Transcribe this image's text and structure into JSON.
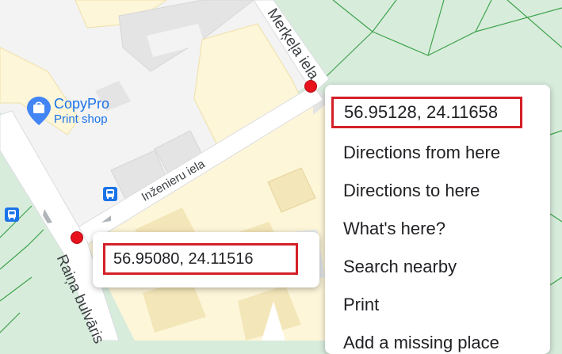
{
  "map": {
    "streets": {
      "merkela": "Merķeļa iela",
      "inzenieru": "Inženieru iela",
      "raina": "Raiņa bulvāris"
    },
    "poi": {
      "name": "CopyPro",
      "category": "Print shop",
      "icon": "shopping-bag-pin-icon"
    },
    "colors": {
      "park": "#d8ecdc",
      "block": "#f8f9fa",
      "building_yellow": "#fef6d9",
      "building_gray": "#ececec",
      "pin": "#e8121d",
      "highlight_border": "#d42028",
      "poi_text": "#1a73e8"
    }
  },
  "context_menu": {
    "coordinates": "56.95128, 24.11658",
    "items": [
      "Directions from here",
      "Directions to here",
      "What's here?",
      "Search nearby",
      "Print",
      "Add a missing place"
    ]
  },
  "coordinate_card": {
    "coordinates": "56.95080, 24.11516"
  }
}
